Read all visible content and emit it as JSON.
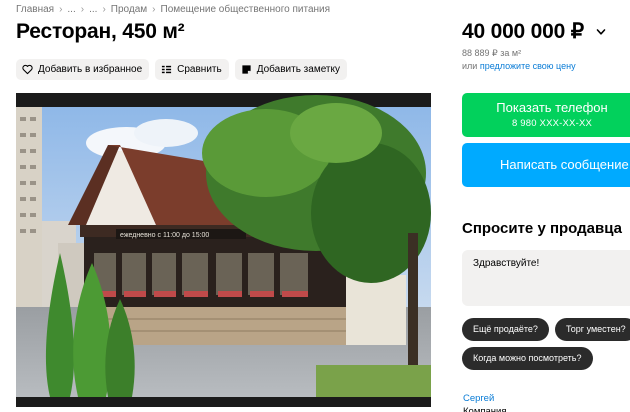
{
  "breadcrumbs": {
    "home": "Главная",
    "ellipsis1": "...",
    "ellipsis2": "...",
    "sale": "Продам",
    "category": "Помещение общественного питания",
    "separator": "›"
  },
  "listing": {
    "title": "Ресторан, 450 м²"
  },
  "actions": {
    "favorite": "Добавить в избранное",
    "compare": "Сравнить",
    "note": "Добавить заметку"
  },
  "gallery": {
    "sign_text": "ежедневно с 11:00 до 15:00"
  },
  "price": {
    "value": "40 000 000 ₽",
    "per_m2": "88 889 ₽ за м²",
    "offer_prefix": "или",
    "offer_link": "предложите свою цену"
  },
  "contact": {
    "phone_label": "Показать телефон",
    "phone_masked": "8 980 XXX-XX-XX",
    "message_label": "Написать сообщение"
  },
  "ask": {
    "title": "Спросите у продавца",
    "input_value": "Здравствуйте!",
    "quick": [
      "Ещё продаёте?",
      "Торг уместен?",
      "Когда можно посмотреть?"
    ]
  },
  "seller": {
    "name": "Сергей",
    "type": "Компания"
  },
  "colors": {
    "phone_button": "#02d15c",
    "message_button": "#00aaff",
    "link": "#0a7cd6",
    "chip_background": "#f2f1f0",
    "quick_reply_background": "#2b2b2b"
  },
  "icons": {
    "favorite": "heart-icon",
    "compare": "compare-icon",
    "note": "note-icon",
    "price_toggle": "chevron-down-icon"
  }
}
